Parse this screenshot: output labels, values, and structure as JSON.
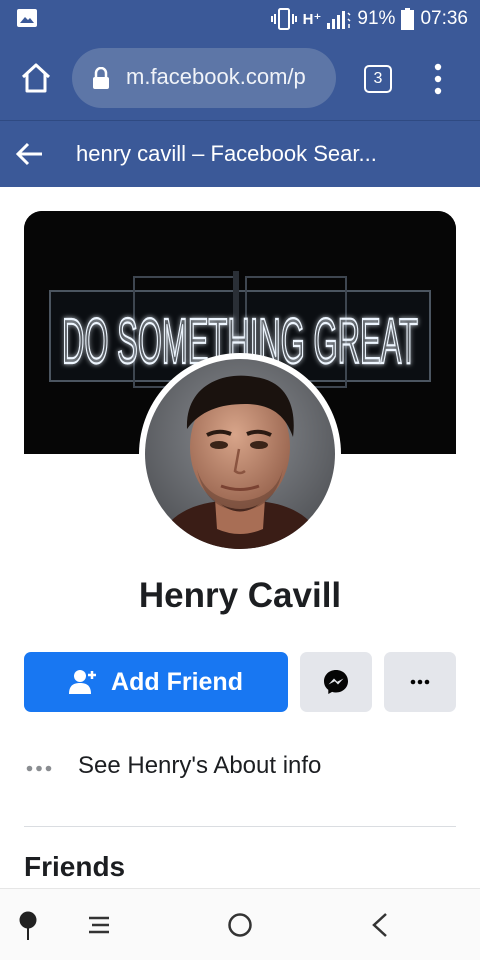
{
  "status_bar": {
    "network": "H⁺",
    "battery": "91%",
    "time": "07:36"
  },
  "browser": {
    "url": "m.facebook.com/p",
    "tab_count": "3"
  },
  "header": {
    "title": "henry cavill – Facebook Sear..."
  },
  "profile": {
    "name": "Henry Cavill",
    "cover_text": "DO SOMETHING GREAT",
    "add_friend_label": "Add Friend",
    "about_label": "See Henry's About info"
  },
  "sections": {
    "friends_heading": "Friends"
  },
  "colors": {
    "brand_blue": "#3b5998",
    "button_blue": "#1877f2",
    "secondary_button": "#e4e6eb"
  },
  "icons": {
    "status": [
      "gallery-icon",
      "vibrate-icon",
      "signal-icon",
      "battery-icon"
    ],
    "browser": [
      "home-icon",
      "lock-icon",
      "tabs-icon",
      "menu-icon"
    ],
    "profile": [
      "add-friend-icon",
      "messenger-icon",
      "more-icon",
      "more-dots-icon"
    ],
    "nav": [
      "pin-icon",
      "menu-lines-icon",
      "home-circle-icon",
      "back-icon"
    ]
  }
}
